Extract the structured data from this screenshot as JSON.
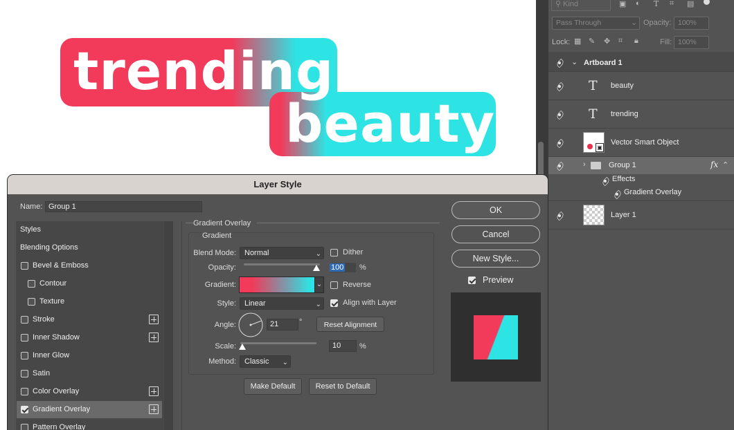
{
  "colors": {
    "pink": "#f23a5a",
    "cyan": "#2ee3e3"
  },
  "canvas": {
    "logo_line1": "trending",
    "logo_line2": "beauty"
  },
  "layers_panel": {
    "filter_kind": "Kind",
    "blend_mode": "Pass Through",
    "opacity_label": "Opacity:",
    "opacity_value": "100%",
    "lock_label": "Lock:",
    "fill_label": "Fill:",
    "fill_value": "100%",
    "artboard": "Artboard 1",
    "layers": [
      {
        "name": "beauty",
        "icon": "type-icon"
      },
      {
        "name": "trending",
        "icon": "type-icon"
      },
      {
        "name": "Vector Smart Object",
        "icon": "smart-object-icon"
      },
      {
        "name": "Group 1",
        "icon": "folder-icon",
        "fx": "fx"
      },
      {
        "name": "Layer 1",
        "icon": "transparent-thumbnail"
      }
    ],
    "effects_label": "Effects",
    "effect_item": "Gradient Overlay"
  },
  "dialog": {
    "title": "Layer Style",
    "name_label": "Name:",
    "name_value": "Group 1",
    "styles": [
      {
        "label": "Styles",
        "checkbox": false
      },
      {
        "label": "Blending Options",
        "checkbox": false
      },
      {
        "label": "Bevel & Emboss",
        "checkbox": true,
        "checked": false
      },
      {
        "label": "Contour",
        "checkbox": true,
        "checked": false
      },
      {
        "label": "Texture",
        "checkbox": true,
        "checked": false
      },
      {
        "label": "Stroke",
        "checkbox": true,
        "checked": false,
        "plus": true
      },
      {
        "label": "Inner Shadow",
        "checkbox": true,
        "checked": false,
        "plus": true
      },
      {
        "label": "Inner Glow",
        "checkbox": true,
        "checked": false
      },
      {
        "label": "Satin",
        "checkbox": true,
        "checked": false
      },
      {
        "label": "Color Overlay",
        "checkbox": true,
        "checked": false,
        "plus": true
      },
      {
        "label": "Gradient Overlay",
        "checkbox": true,
        "checked": true,
        "plus": true
      },
      {
        "label": "Pattern Overlay",
        "checkbox": true,
        "checked": false
      }
    ],
    "section_title": "Gradient Overlay",
    "group_title": "Gradient",
    "blend_mode_label": "Blend Mode:",
    "blend_mode_value": "Normal",
    "dither_label": "Dither",
    "opacity_label": "Opacity:",
    "opacity_value": "100",
    "percent": "%",
    "gradient_label": "Gradient:",
    "reverse_label": "Reverse",
    "style_label": "Style:",
    "style_value": "Linear",
    "align_label": "Align with Layer",
    "angle_label": "Angle:",
    "angle_value": "21",
    "degree": "°",
    "reset_alignment": "Reset Alignment",
    "scale_label": "Scale:",
    "scale_value": "10",
    "method_label": "Method:",
    "method_value": "Classic",
    "make_default": "Make Default",
    "reset_default": "Reset to Default",
    "ok": "OK",
    "cancel": "Cancel",
    "new_style": "New Style...",
    "preview_label": "Preview",
    "preview_checked": true,
    "opacity_slider_fraction": 1.0,
    "scale_slider_fraction": 0.1,
    "angle_degrees": 21
  }
}
